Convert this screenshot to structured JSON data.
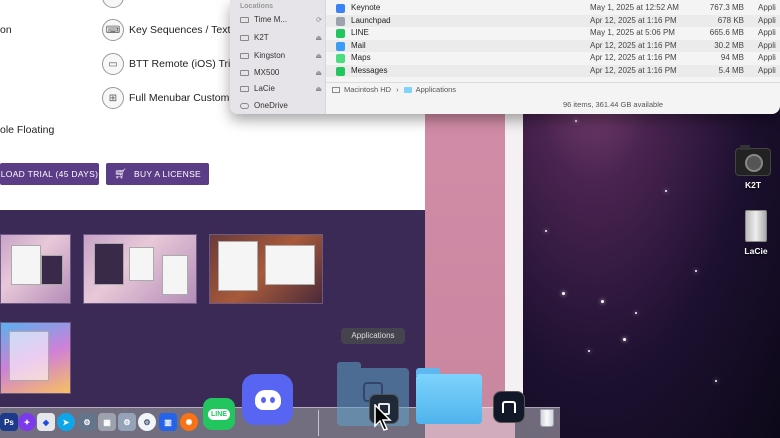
{
  "webpage": {
    "features": [
      {
        "icon": "keyboard-icon",
        "label": "Key Sequences / Text T"
      },
      {
        "icon": "remote-icon",
        "label": "BTT Remote (iOS) Trigg"
      },
      {
        "icon": "menubar-icon",
        "label": "Full Menubar Customiz"
      }
    ],
    "left_fragments": {
      "top": "on",
      "middle": "ole Floating"
    },
    "trial_button": "LOAD TRIAL (45 DAYS)",
    "buy_button": "BUY A LICENSE"
  },
  "finder": {
    "sidebar_header": "Locations",
    "locations": [
      {
        "label": "Time M...",
        "eject": "⟳"
      },
      {
        "label": "K2T",
        "eject": "⏏"
      },
      {
        "label": "Kingston",
        "eject": "⏏"
      },
      {
        "label": "MX500",
        "eject": "⏏"
      },
      {
        "label": "LaCie",
        "eject": "⏏"
      },
      {
        "label": "OneDrive",
        "eject": ""
      }
    ],
    "files": [
      {
        "name": "Keynote",
        "date": "May 1, 2025 at 12:52 AM",
        "size": "767.3 MB",
        "kind": "Appli",
        "color": "#3b82f6"
      },
      {
        "name": "Launchpad",
        "date": "Apr 12, 2025 at 1:16 PM",
        "size": "678 KB",
        "kind": "Appli",
        "color": "#9ca3af"
      },
      {
        "name": "LINE",
        "date": "May 1, 2025 at 5:06 PM",
        "size": "665.6 MB",
        "kind": "Appli",
        "color": "#22c55e"
      },
      {
        "name": "Mail",
        "date": "Apr 12, 2025 at 1:16 PM",
        "size": "30.2 MB",
        "kind": "Appli",
        "color": "#3b9cf6"
      },
      {
        "name": "Maps",
        "date": "Apr 12, 2025 at 1:16 PM",
        "size": "94 MB",
        "kind": "Appli",
        "color": "#4ade80"
      },
      {
        "name": "Messages",
        "date": "Apr 12, 2025 at 1:16 PM",
        "size": "5.4 MB",
        "kind": "Appli",
        "color": "#22c55e"
      }
    ],
    "path": {
      "disk": "Macintosh HD",
      "separator": "›",
      "folder": "Applications"
    },
    "status": "96 items, 361.44 GB available"
  },
  "desktop": {
    "icons": [
      {
        "label": "K2T",
        "icon": "camera-icon"
      },
      {
        "label": "LaCie",
        "icon": "external-drive-icon"
      }
    ]
  },
  "dock": {
    "tooltip": "Applications",
    "apps": [
      {
        "name": "photoshop-icon",
        "label": "Ps",
        "color": "#1e3a8a"
      },
      {
        "name": "slack-icon",
        "label": "✦",
        "color": "#7c3aed"
      },
      {
        "name": "shield-icon",
        "label": "◆",
        "color": "#e5e7eb"
      },
      {
        "name": "telegram-icon",
        "label": "➤",
        "color": "#0ea5e9"
      },
      {
        "name": "settings-icon",
        "label": "⚙",
        "color": "#64748b"
      },
      {
        "name": "cube-icon",
        "label": "▦",
        "color": "#9ca3af"
      },
      {
        "name": "gear-icon",
        "label": "⚙",
        "color": "#94a3b8"
      },
      {
        "name": "trello-icon",
        "label": "▥",
        "color": "#2563eb"
      },
      {
        "name": "orange-app-icon",
        "label": "✺",
        "color": "#f97316"
      },
      {
        "name": "line-app-icon",
        "label": "LINE",
        "color": "#22c55e"
      },
      {
        "name": "discord-icon",
        "label": "◕",
        "color": "#5865f2"
      }
    ],
    "accent": "#7dd3fc"
  }
}
